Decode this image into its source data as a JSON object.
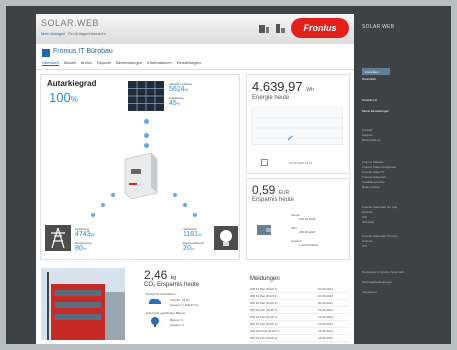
{
  "header": {
    "brand": "SOLAR.WEB",
    "sub_link": "Mein Anlagen",
    "sub_text": "Ein Anlagenübersicht",
    "logo_text": "Fronius"
  },
  "system": {
    "title": "Fronius IT Bürobau",
    "nav": [
      "Übersicht",
      "Aktuell",
      "Archiv",
      "Reports",
      "Berechnungen",
      "Informationen",
      "Einstellungen"
    ]
  },
  "flow": {
    "autarky_label": "Autarkiegrad",
    "autarky_value": "100",
    "autarky_unit": "%",
    "pv_label": "Aktuelle Leistung",
    "pv_value": "5624",
    "pv_unit": "W",
    "pv_label2": "Auslastung",
    "pv_value2": "45",
    "pv_unit2": "%",
    "grid_label": "Netzbezug",
    "grid_value": "4743",
    "grid_unit": "W",
    "grid_label2": "Einspeisung",
    "grid_value2": "80",
    "grid_unit2": "%",
    "load_label": "Verbrauch",
    "load_value": "1181",
    "load_unit": "W",
    "load_label2": "Eigenverbrauch",
    "load_value2": "20",
    "load_unit2": "%"
  },
  "energy": {
    "value": "4.639,97",
    "unit": "Wh",
    "label": "Energie heute",
    "date": "20.09.2012 14:17"
  },
  "savings": {
    "value": "0,59",
    "unit": "EUR",
    "label": "Ersparnis heute",
    "line1_label": "Monat",
    "line1_value": "105,01 EUR",
    "line2_label": "Jahr",
    "line2_value": "456,90 EUR",
    "line3_label": "Gesamt",
    "line3_value": "1.216,84 EUR"
  },
  "co2": {
    "value": "2,46",
    "unit": "kg",
    "label": "CO₂ Ersparnis heute",
    "line1": "Entspricht Autofahrten ...",
    "line2": "Strecke: 19 km",
    "line3": "Gesamt: 1.499,67 km",
    "line4": "Entspricht gepflanzter Bäume ...",
    "line5": "Bäume: 0",
    "line6": "Gesamt: 3"
  },
  "messages": {
    "title": "Meldungen",
    "rows": [
      {
        "text": "WR 10 Pac (8 kW 1)",
        "date": "20.09.2012"
      },
      {
        "text": "WR 10 Pac (8 kW 1)",
        "date": "20.09.2012"
      },
      {
        "text": "WR 10 Pac (8 kW 1)",
        "date": "20.09.2012"
      },
      {
        "text": "WR 10 Pac (8 kW 1)",
        "date": "19.09.2012"
      },
      {
        "text": "WR 10 Pac (8 kW 1)",
        "date": "19.09.2012"
      },
      {
        "text": "WR 10 Pac (8 kW 1)",
        "date": "19.09.2012"
      },
      {
        "text": "WR Wechsel (8 kW 1)",
        "date": "18.09.2012"
      },
      {
        "text": "WR 10 Pac (8 kW 1)",
        "date": "18.09.2012"
      },
      {
        "text": "WR 10 Pac (8 kW 1)",
        "date": "18.09.2012"
      }
    ]
  },
  "sidebar": {
    "title": "SOLAR.WEB",
    "button": "Anmelden",
    "items": [
      "Persönlich",
      "Produkt (4)",
      "Meine Einstellungen",
      "Kontakt",
      "Support",
      "Rückmeldung",
      "Fronius Website",
      "Fronius Solar.configurator",
      "Fronius Solar.TV",
      "Fronius Solar.web",
      "Installateursuche",
      "Referenzliste",
      "Fronius Solar.web pro App",
      "Android",
      "iOS",
      "Windows",
      "Fronius Solar.web Pro App",
      "Android",
      "iOS",
      "Newsletter & Fronius Solar.web",
      "Nutzungsbedingungen",
      "Impressum"
    ]
  }
}
